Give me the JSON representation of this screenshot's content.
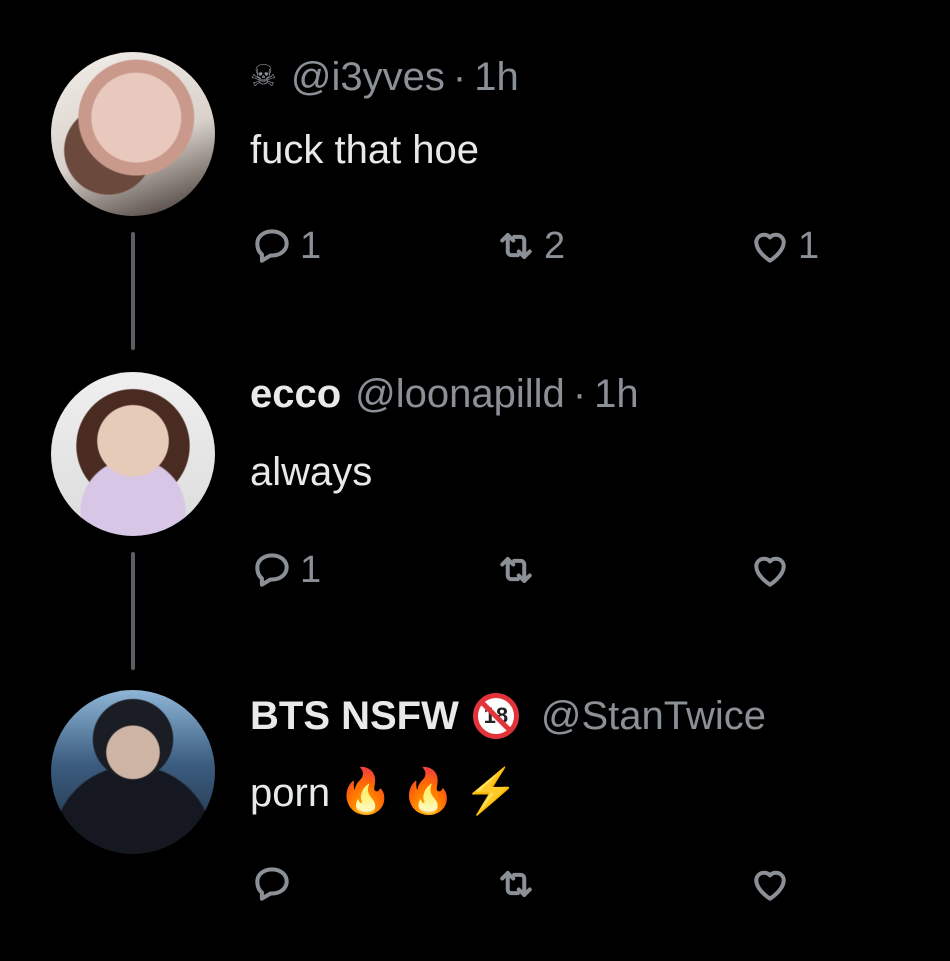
{
  "tweets": [
    {
      "name": "",
      "prefix_icon": "skull-crossbones-icon",
      "prefix_glyph": "☠",
      "handle": "@i3yves",
      "separator": "·",
      "time": "1h",
      "text": "fuck that hoe",
      "emojis": "",
      "counts": {
        "reply": "1",
        "retweet": "2",
        "like": "1"
      }
    },
    {
      "name": "ecco",
      "handle": "@loonapilld",
      "separator": "·",
      "time": "1h",
      "text": "always",
      "counts": {
        "reply": "1",
        "retweet": "",
        "like": ""
      }
    },
    {
      "name": "BTS NSFW",
      "badge": "18",
      "handle": "@StanTwice",
      "text": "porn",
      "emojis": {
        "fire1": "🔥",
        "fire2": "🔥",
        "bolt": "⚡"
      },
      "counts": {
        "reply": "",
        "retweet": "",
        "like": ""
      }
    }
  ],
  "colors": {
    "background": "#000000",
    "text": "#e7e9ea",
    "muted": "#8b9096",
    "thread_line": "#5a5f64",
    "nsfw_red": "#e0333a"
  }
}
